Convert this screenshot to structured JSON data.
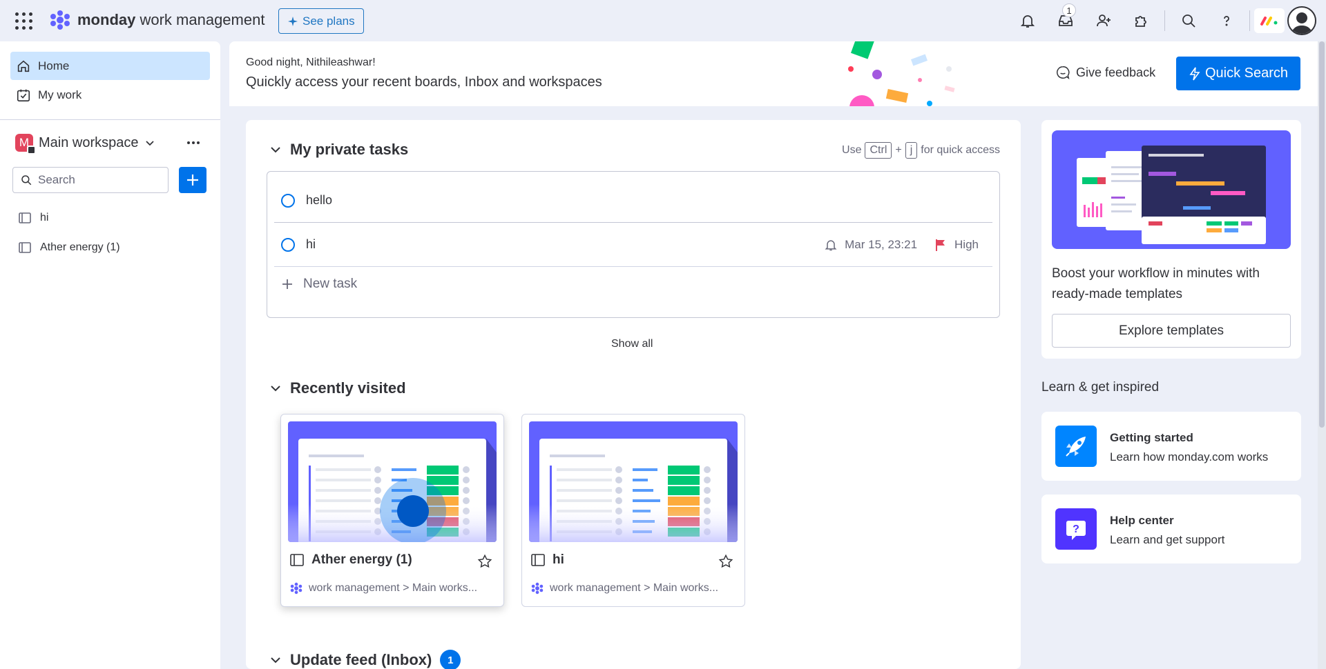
{
  "topbar": {
    "brand_bold": "monday",
    "brand_rest": " work management",
    "see_plans": "See plans",
    "inbox_badge": "1"
  },
  "sidebar": {
    "home": "Home",
    "my_work": "My work",
    "workspace_initial": "M",
    "workspace_name": "Main workspace",
    "search_placeholder": "Search",
    "boards": [
      "hi",
      "Ather energy (1)"
    ]
  },
  "header": {
    "greeting": "Good night, Nithileashwar!",
    "subtitle": "Quickly access your recent boards, Inbox and workspaces",
    "feedback": "Give feedback",
    "quick_search": "Quick Search"
  },
  "private_tasks": {
    "title": "My private tasks",
    "shortcut_use": "Use",
    "shortcut_key1": "Ctrl",
    "shortcut_plus": "+",
    "shortcut_key2": "j",
    "shortcut_rest": "for quick access",
    "tasks": [
      {
        "name": "hello"
      },
      {
        "name": "hi",
        "date": "Mar 15, 23:21",
        "priority": "High"
      }
    ],
    "new_task": "New task",
    "show_all": "Show all"
  },
  "recently_visited": {
    "title": "Recently visited",
    "boards": [
      {
        "name": "Ather energy (1)",
        "path": "work management > Main works..."
      },
      {
        "name": "hi",
        "path": "work management > Main works..."
      }
    ]
  },
  "update_feed": {
    "title": "Update feed (Inbox)",
    "count": "1"
  },
  "templates": {
    "text": "Boost your workflow in minutes with ready-made templates",
    "button": "Explore templates"
  },
  "learn": {
    "title": "Learn & get inspired",
    "cards": [
      {
        "title": "Getting started",
        "subtitle": "Learn how monday.com works"
      },
      {
        "title": "Help center",
        "subtitle": "Learn and get support"
      }
    ]
  },
  "colors": {
    "primary": "#0073ea",
    "accent_purple": "#6161ff",
    "priority_flag": "#e2445c"
  }
}
